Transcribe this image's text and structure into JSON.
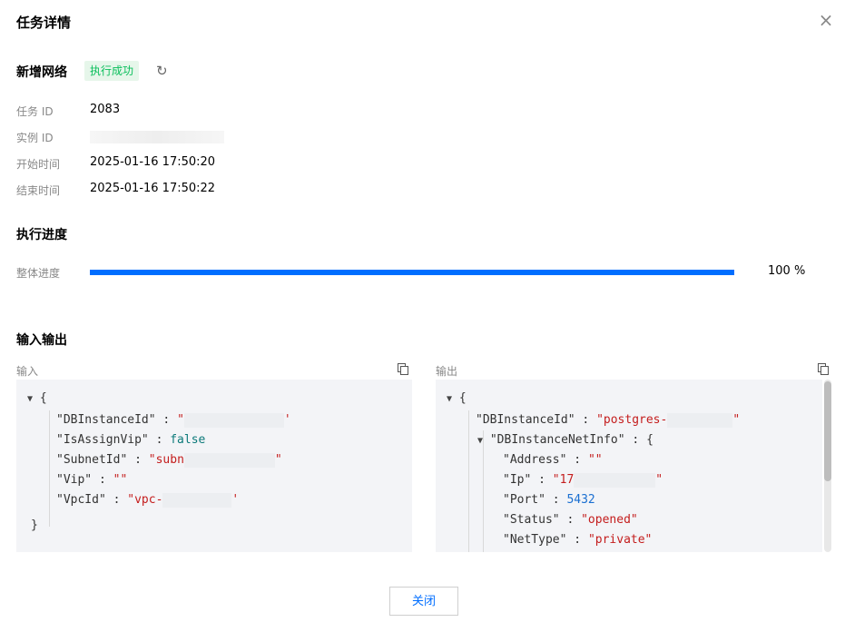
{
  "dialog": {
    "title": "任务详情",
    "close_icon": "close-icon"
  },
  "task": {
    "name": "新增网络",
    "status": "执行成功",
    "refresh_icon": "refresh-icon",
    "fields": [
      {
        "label": "任务 ID",
        "value": "2083"
      },
      {
        "label": "实例 ID",
        "value": ""
      },
      {
        "label": "开始时间",
        "value": "2025-01-16 17:50:20"
      },
      {
        "label": "结束时间",
        "value": "2025-01-16 17:50:22"
      }
    ]
  },
  "progress": {
    "section_title": "执行进度",
    "label": "整体进度",
    "percent": 100,
    "percent_text": "100 %"
  },
  "io": {
    "section_title": "输入输出",
    "input_label": "输入",
    "output_label": "输出",
    "copy_icon": "copy-icon",
    "input_lines": {
      "open": "{",
      "k1": "\"DBInstanceId\"",
      "v1": "\"",
      "v1_end": "'",
      "k2": "\"IsAssignVip\"",
      "v2": "false",
      "k3": "\"SubnetId\"",
      "v3": "\"subn",
      "v3_end": "\"",
      "k4": "\"Vip\"",
      "v4": "\"\"",
      "k5": "\"VpcId\"",
      "v5": "\"vpc-",
      "v5_end": "'",
      "close": "}"
    },
    "output_lines": {
      "open": "{",
      "k1": "\"DBInstanceId\"",
      "v1": "\"postgres-",
      "v1_end": "\"",
      "k2": "\"DBInstanceNetInfo\"",
      "v2": "{",
      "k3": "\"Address\"",
      "v3": "\"\"",
      "k4": "\"Ip\"",
      "v4": "\"17",
      "v4_end": "\"",
      "k5": "\"Port\"",
      "v5": "5432",
      "k6": "\"Status\"",
      "v6": "\"opened\"",
      "k7": "\"NetType\"",
      "v7": "\"private\""
    },
    "sep": " : "
  },
  "footer": {
    "close_button": "关闭"
  }
}
